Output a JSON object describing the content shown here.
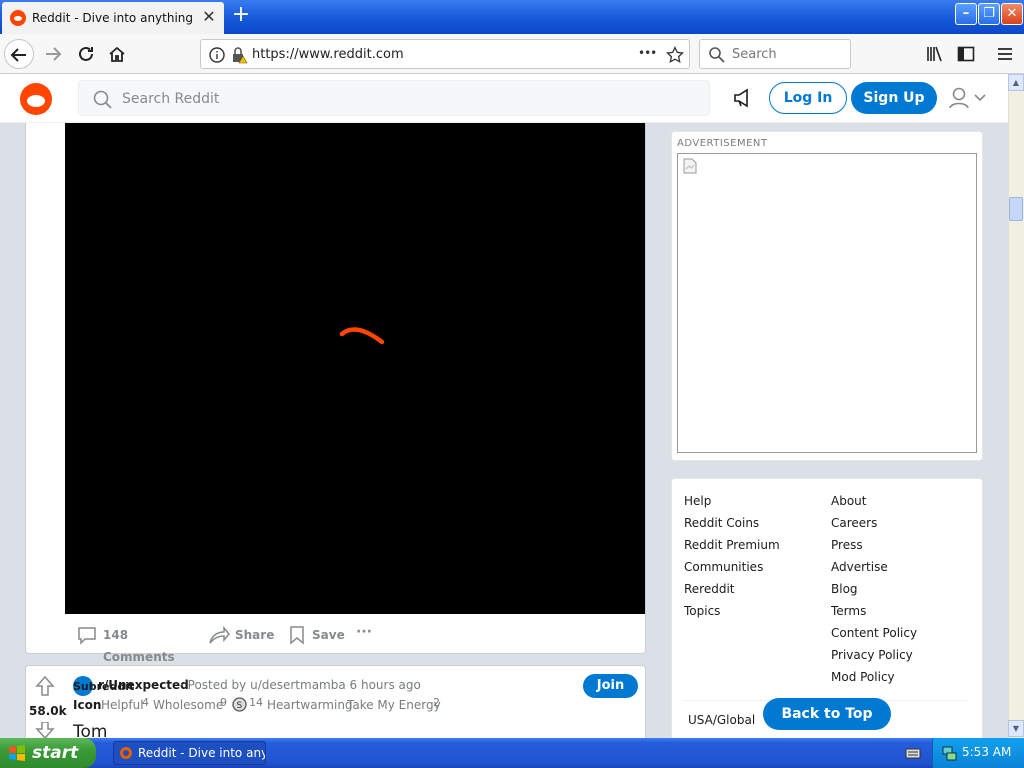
{
  "browser": {
    "tab_title": "Reddit - Dive into anything",
    "tab_close": "✕",
    "new_tab": "+",
    "url": "https://www.reddit.com",
    "url_menu": "•••",
    "search_placeholder": "Search",
    "window_buttons": {
      "minimize": "–",
      "restore": "❐",
      "close": "✕"
    }
  },
  "reddit_header": {
    "search_placeholder": "Search Reddit",
    "login_label": "Log In",
    "signup_label": "Sign Up"
  },
  "post": {
    "actions": {
      "comments": "148 Comments",
      "share": "Share",
      "save": "Save",
      "more": "···"
    }
  },
  "post2": {
    "vote_count": "58.0k",
    "subreddit_icon_alt": "Subreddit",
    "subreddit": "r/Unexpected",
    "posted_by": "· Posted by u/desertmamba 6 hours ago",
    "join_label": "Join",
    "awards": [
      {
        "icon_text": "Icon",
        "name": "Helpful",
        "count": "4"
      },
      {
        "name": "Wholesome",
        "count": "9"
      },
      {
        "name": "",
        "count": "14"
      },
      {
        "name": "Heartwarming",
        "count": ""
      },
      {
        "name": "Take My Energy",
        "count": "2"
      }
    ],
    "title_start": "Tom"
  },
  "sidebar": {
    "ad_label": "ADVERTISEMENT",
    "links_left": [
      "Help",
      "Reddit Coins",
      "Reddit Premium",
      "Communities",
      "Rereddit",
      "Topics"
    ],
    "links_right": [
      "About",
      "Careers",
      "Press",
      "Advertise",
      "Blog",
      "Terms",
      "Content Policy",
      "Privacy Policy",
      "Mod Policy"
    ],
    "region": "USA/Global",
    "back_to_top": "Back to Top"
  },
  "taskbar": {
    "start_label": "start",
    "task_item": "Reddit - Dive into any...",
    "clock": "5:53 AM"
  },
  "colors": {
    "reddit_orange": "#ff4500",
    "reddit_blue": "#0079d3"
  }
}
